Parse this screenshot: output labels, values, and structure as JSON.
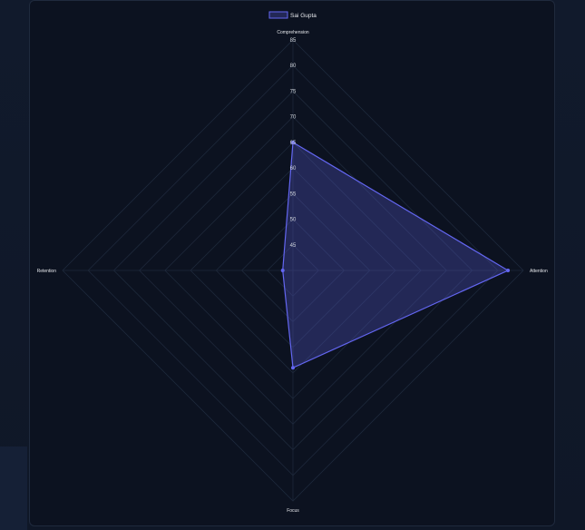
{
  "chart_data": {
    "type": "radar",
    "axes": [
      "Comprehension",
      "Attention",
      "Focus",
      "Retention"
    ],
    "series": [
      {
        "name": "Sai Gupta",
        "values": [
          65,
          82,
          59,
          42
        ],
        "color": "#6366f1",
        "fill": "rgba(79, 82, 190, 0.35)"
      }
    ],
    "scale": {
      "min": 40,
      "max": 85,
      "step": 5
    },
    "ticks": [
      45,
      50,
      55,
      60,
      65,
      70,
      75,
      80,
      85
    ],
    "legend": "top"
  },
  "colors": {
    "grid": "#1e293b",
    "background": "#0c1220",
    "text": "#e5e7eb"
  }
}
